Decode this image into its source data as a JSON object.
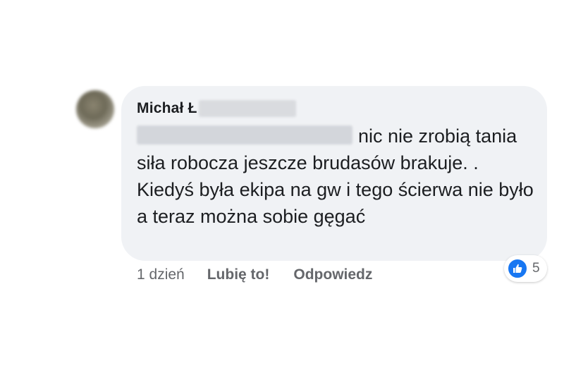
{
  "comment": {
    "author_first": "Michał Ł",
    "text_line1_after_mention": "nic nie zrobią",
    "text_rest": "tania siła robocza jeszcze brudasów brakuje. . Kiedyś była ekipa na gw i tego ścierwa  nie było a teraz można sobie gęgać"
  },
  "actions": {
    "time": "1 dzień",
    "like_label": "Lubię to!",
    "reply_label": "Odpowiedz"
  },
  "reactions": {
    "icon": "thumbs-up-icon",
    "count": "5",
    "color": "#1877f2"
  },
  "colors": {
    "bubble": "#f0f2f5",
    "text": "#1c1e21",
    "secondary_text": "#65676b"
  }
}
